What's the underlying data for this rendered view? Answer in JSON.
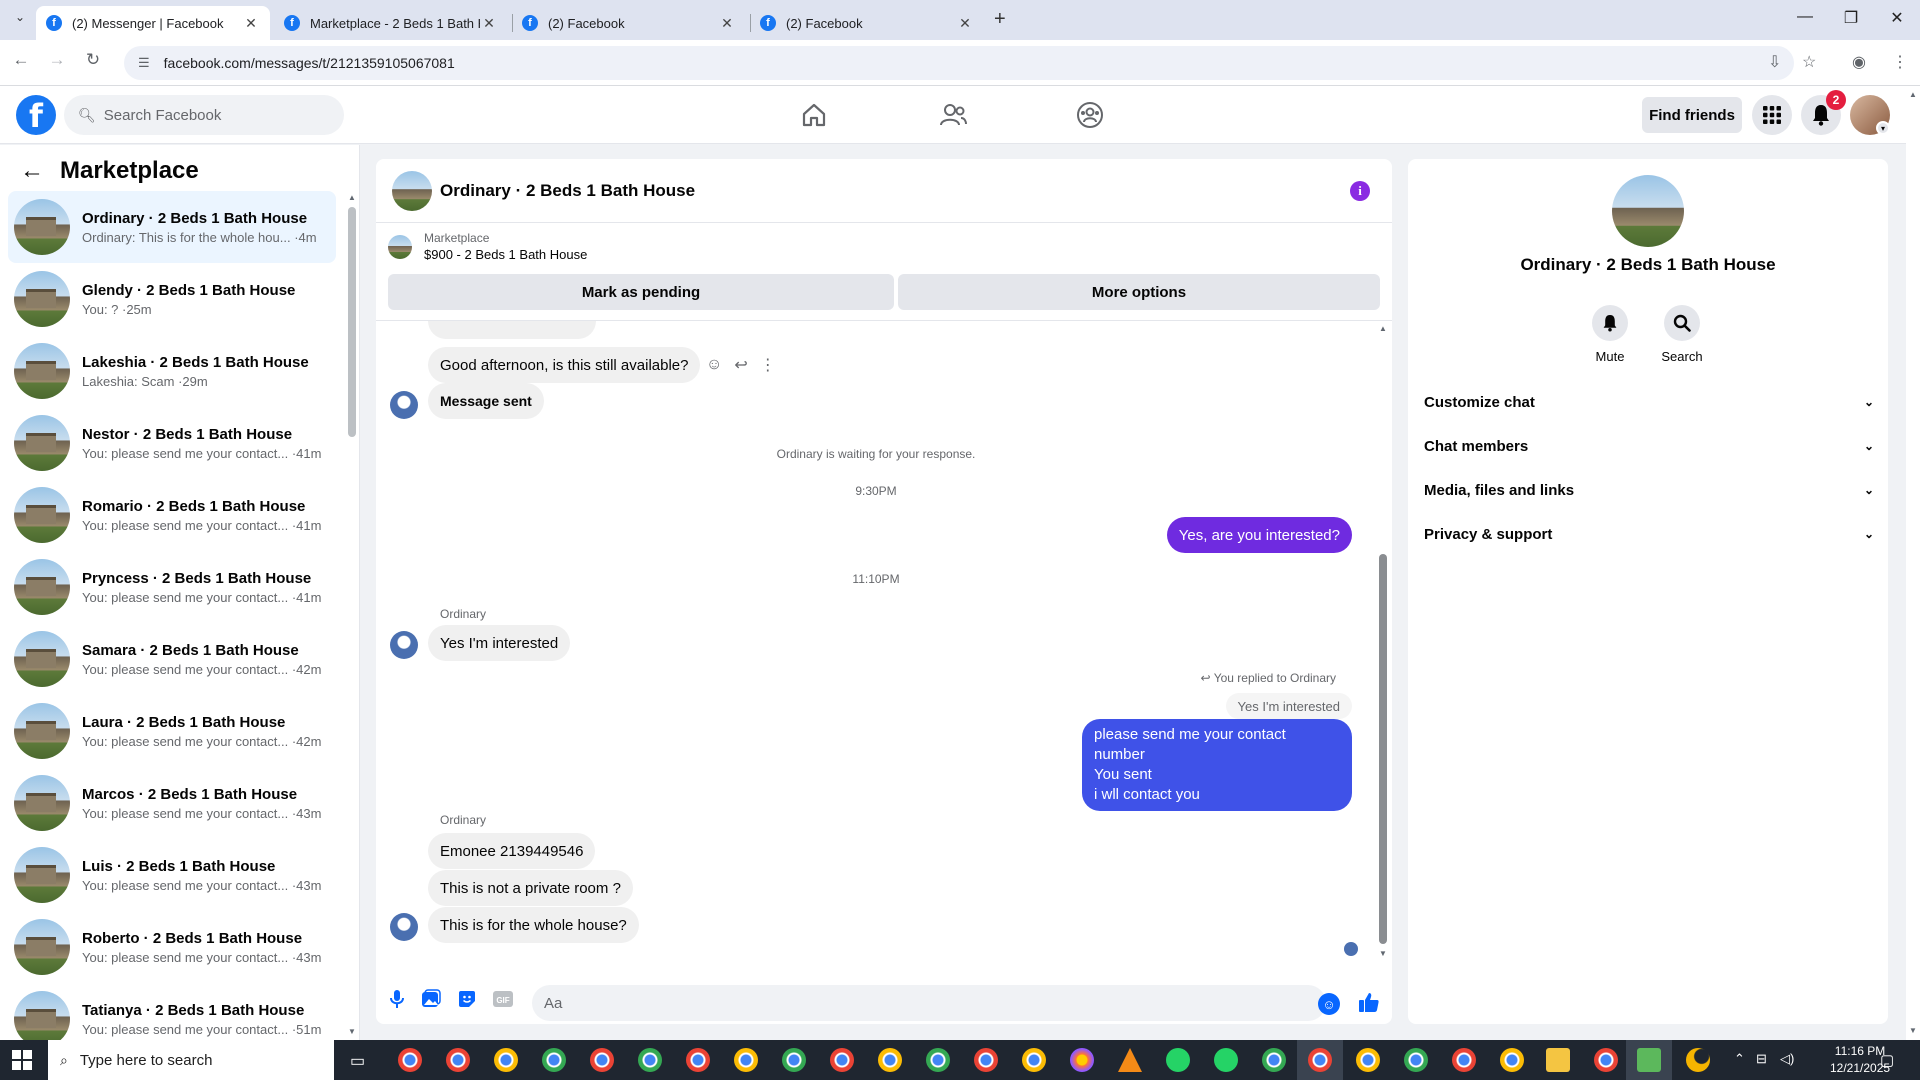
{
  "browser": {
    "tabs": [
      {
        "title": "(2) Messenger | Facebook",
        "active": true
      },
      {
        "title": "Marketplace - 2 Beds 1 Bath Ho",
        "active": false
      },
      {
        "title": "(2) Facebook",
        "active": false
      },
      {
        "title": "(2) Facebook",
        "active": false
      }
    ],
    "url": "facebook.com/messages/t/2121359105067081"
  },
  "fb_header": {
    "search_placeholder": "Search Facebook",
    "find_friends": "Find friends",
    "notification_count": "2"
  },
  "sidebar": {
    "title": "Marketplace",
    "conversations": [
      {
        "name": "Ordinary · 2 Beds 1 Bath House",
        "preview": "Ordinary: This is for the whole hou... ·4m",
        "active": true
      },
      {
        "name": "Glendy · 2 Beds 1 Bath House",
        "preview": "You: ? ·25m"
      },
      {
        "name": "Lakeshia · 2 Beds 1 Bath House",
        "preview": "Lakeshia: Scam ·29m"
      },
      {
        "name": "Nestor · 2 Beds 1 Bath House",
        "preview": "You: please send me your contact... ·41m"
      },
      {
        "name": "Romario · 2 Beds 1 Bath House",
        "preview": "You: please send me your contact... ·41m"
      },
      {
        "name": "Pryncess · 2 Beds 1 Bath House",
        "preview": "You: please send me your contact... ·41m"
      },
      {
        "name": "Samara · 2 Beds 1 Bath House",
        "preview": "You: please send me your contact... ·42m"
      },
      {
        "name": "Laura · 2 Beds 1 Bath House",
        "preview": "You: please send me your contact... ·42m"
      },
      {
        "name": "Marcos · 2 Beds 1 Bath House",
        "preview": "You: please send me your contact... ·43m"
      },
      {
        "name": "Luis · 2 Beds 1 Bath House",
        "preview": "You: please send me your contact... ·43m"
      },
      {
        "name": "Roberto · 2 Beds 1 Bath House",
        "preview": "You: please send me your contact... ·43m"
      },
      {
        "name": "Tatianya · 2 Beds 1 Bath House",
        "preview": "You: please send me your contact... ·51m"
      }
    ]
  },
  "chat": {
    "title": "Ordinary · 2 Beds 1 Bath House",
    "marketplace_label": "Marketplace",
    "listing": "$900 - 2 Beds 1 Bath House",
    "mark_pending": "Mark as pending",
    "more_options": "More options",
    "messages": {
      "m1": "Good afternoon, is this still available?",
      "m2": "Message sent",
      "waiting": "Ordinary is waiting for your response.",
      "time1": "9:30PM",
      "out1": "Yes, are you interested?",
      "time2": "11:10PM",
      "sender1": "Ordinary",
      "in1": "Yes I'm interested",
      "replied_to": "You replied to Ordinary",
      "quote": "Yes I'm interested",
      "out2_line1": "please send me your contact number",
      "out2_line2": "You sent",
      "out2_line3": "i wll contact you",
      "sender2": "Ordinary",
      "in2": "Emonee 2139449546",
      "in3": "This is not a private room ?",
      "in4": "This is for the whole house?"
    },
    "composer_placeholder": "Aa"
  },
  "info_panel": {
    "name": "Ordinary · 2 Beds 1 Bath House",
    "actions": [
      "Mute",
      "Search"
    ],
    "sections": [
      "Customize chat",
      "Chat members",
      "Media, files and links",
      "Privacy & support"
    ]
  },
  "taskbar": {
    "search_placeholder": "Type here to search",
    "time": "11:16 PM",
    "date": "12/21/2025"
  }
}
